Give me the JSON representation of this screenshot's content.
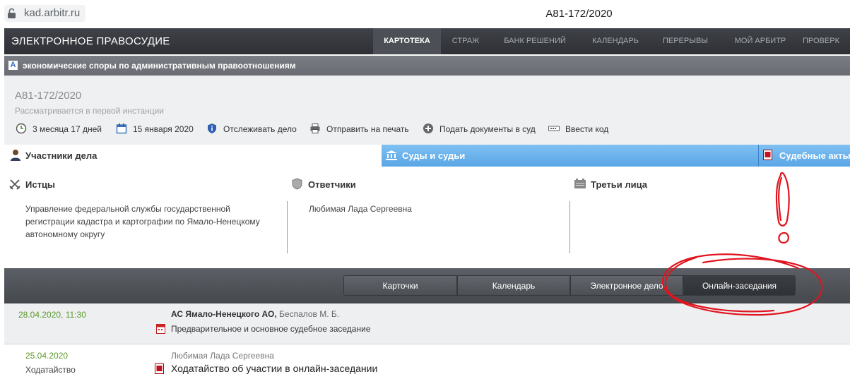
{
  "browser": {
    "url": "kad.arbitr.ru",
    "tab_title": "А81-172/2020"
  },
  "topnav": {
    "brand": "ЭЛЕКТРОННОЕ ПРАВОСУДИЕ",
    "items": [
      "КАРТОТЕКА",
      "СТРАЖ",
      "БАНК РЕШЕНИЙ",
      "КАЛЕНДАРЬ",
      "ПЕРЕРЫВЫ",
      "МОЙ АРБИТР",
      "ПРОВЕРК"
    ],
    "active": "КАРТОТЕКА"
  },
  "category": {
    "icon_letter": "A",
    "label": "экономические споры по административным правоотношениям"
  },
  "case": {
    "number": "А81-172/2020",
    "status": "Рассматривается в первой инстанции",
    "actions": {
      "duration": "3 месяца 17 дней",
      "date": "15 января 2020",
      "track": "Отслеживать дело",
      "print": "Отправить на печать",
      "submit": "Подать документы в суд",
      "code": "Ввести код"
    }
  },
  "tabs": {
    "participants": "Участники дела",
    "courts": "Суды и судьи",
    "acts": "Судебные акты"
  },
  "parties": {
    "plaintiffs_title": "Истцы",
    "plaintiff_lines": [
      "Управление федеральной службы государственной",
      "регистрации кадастра и картографии по Ямало-Ненецкому",
      "автономному округу"
    ],
    "defendants_title": "Ответчики",
    "defendant": "Любимая Лада Сергеевна",
    "third_title": "Третьи лица"
  },
  "toolbar": {
    "cards": "Карточки",
    "calendar": "Календарь",
    "edelo": "Электронное дело",
    "online": "Онлайн-заседания"
  },
  "entries": [
    {
      "date": "28.04.2020, 11:30",
      "court": "АС Ямало-Ненецкого АО,",
      "judge": "Беспалов М. Б.",
      "desc": "Предварительное и основное судебное заседание"
    },
    {
      "date": "25.04.2020",
      "type": "Ходатайство",
      "author": "Любимая Лада Сергеевна",
      "doc": "Ходатайство об участии в онлайн-заседании"
    }
  ],
  "colors": {
    "annotation": "#e0141e",
    "accent_blue": "#5aa6e6",
    "green_date": "#5b9a2a"
  }
}
